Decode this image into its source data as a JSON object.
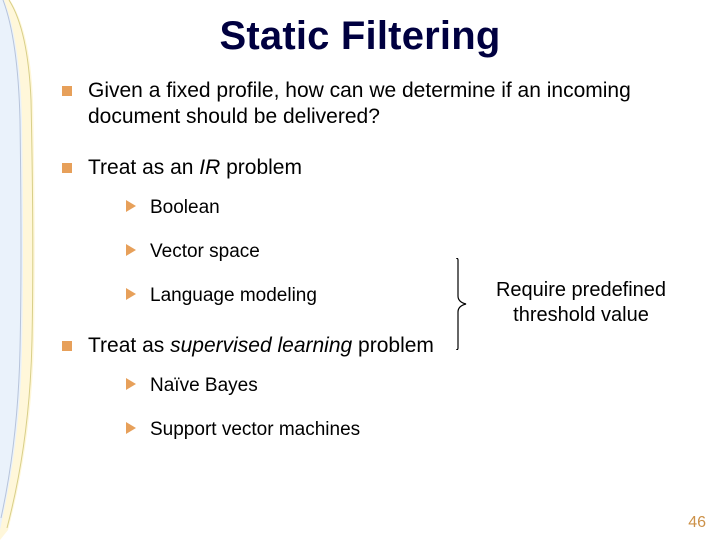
{
  "title": "Static Filtering",
  "bullets": {
    "b1": "Given a fixed profile, how can we determine if an incoming document should be delivered?",
    "b2_pre": "Treat as an ",
    "b2_em": "IR",
    "b2_post": " problem",
    "b2_sub": {
      "s1": "Boolean",
      "s2": "Vector space",
      "s3": "Language modeling"
    },
    "b3_pre": "Treat as ",
    "b3_em": "supervised learning",
    "b3_post": " problem",
    "b3_sub": {
      "s1": "Naïve Bayes",
      "s2": "Support vector machines"
    }
  },
  "annotation": "Require predefined threshold value",
  "page_number": "46"
}
